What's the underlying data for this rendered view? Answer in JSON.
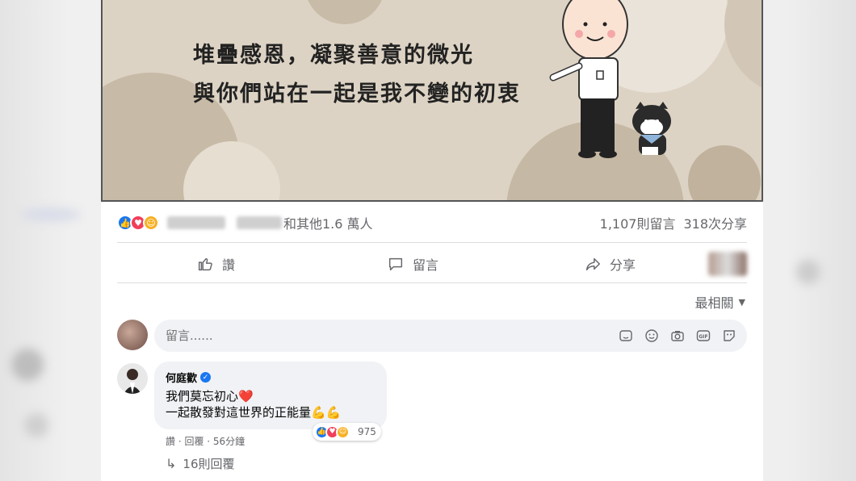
{
  "post": {
    "image_caption_line1": "堆疊感恩，凝聚善意的微光",
    "image_caption_line2": "與你們站在一起是我不變的初衷",
    "reactions_text": "和其他1.6 萬人",
    "comments_count": "1,107則留言",
    "shares_count": "318次分享",
    "colors": {
      "like": "#1877f2",
      "love": "#f33e58",
      "care": "#f7b125"
    }
  },
  "actions": {
    "like_label": "讚",
    "comment_label": "留言",
    "share_label": "分享"
  },
  "sort": {
    "label": "最相關"
  },
  "comment_box": {
    "placeholder": "留言......"
  },
  "comment": {
    "author": "何庭歡",
    "line1": "我們莫忘初心❤️",
    "line2": "一起散發對這世界的正能量💪💪",
    "reaction_count": "975",
    "meta": "讚 · 回覆 · 56分鐘",
    "replies": "16則回覆"
  }
}
